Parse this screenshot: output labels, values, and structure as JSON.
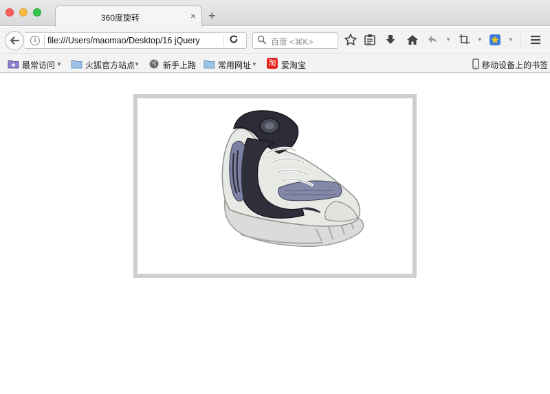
{
  "window": {
    "tab_title": "360度旋转",
    "close_tab_glyph": "×",
    "new_tab_glyph": "+"
  },
  "navbar": {
    "url": "file:///Users/maomao/Desktop/16 jQuery",
    "search_placeholder": "百度 <⌘K>",
    "icons": [
      "back-icon",
      "info-icon",
      "reload-icon",
      "search-icon",
      "bookmark-star-icon",
      "reader-icon",
      "download-icon",
      "home-icon",
      "undo-icon",
      "crop-icon",
      "favorites-icon",
      "menu-icon"
    ]
  },
  "bookmarks": {
    "items": [
      {
        "label": "最常访问",
        "icon": "smart-folder-icon",
        "has_dropdown": true
      },
      {
        "label": "火狐官方站点",
        "icon": "folder-icon",
        "has_dropdown": true
      },
      {
        "label": "新手上路",
        "icon": "globe-icon",
        "has_dropdown": false
      },
      {
        "label": "常用网址",
        "icon": "folder-icon",
        "has_dropdown": true
      },
      {
        "label": "爱淘宝",
        "icon": "taobao-icon",
        "has_dropdown": false
      }
    ],
    "mobile_label": "移动设备上的书签",
    "taobao_glyph": "淘"
  },
  "content": {
    "image": "sneaker-product-image",
    "colors": {
      "frame_border": "#cfcfcf",
      "shoe_dark": "#2a2a35",
      "shoe_light": "#e4e6e2",
      "shoe_accent": "#7b80a0"
    }
  }
}
